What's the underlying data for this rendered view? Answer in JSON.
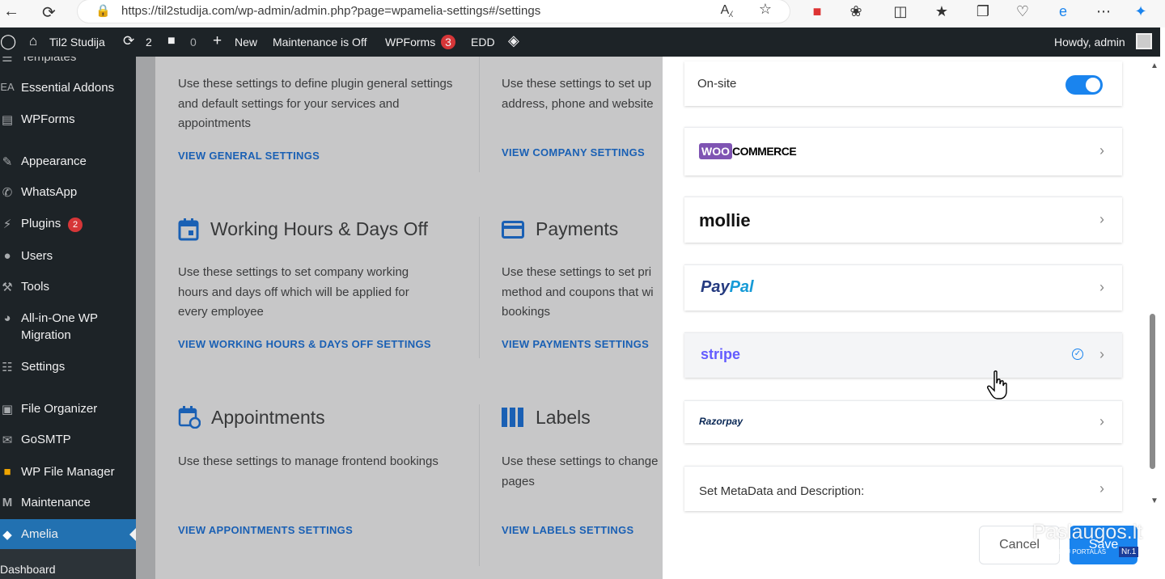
{
  "browser": {
    "url": "https://til2studija.com/wp-admin/admin.php?page=wpamelia-settings#/settings"
  },
  "adminbar": {
    "site_name": "Til2 Studija",
    "updates_count": "2",
    "comments_count": "0",
    "new_label": "New",
    "maintenance_label": "Maintenance is Off",
    "wpforms_label": "WPForms",
    "wpforms_badge": "3",
    "edd_label": "EDD",
    "howdy": "Howdy, admin"
  },
  "sidebar": {
    "items": [
      {
        "label": "Templates",
        "icon": "templates-icon"
      },
      {
        "label": "Essential Addons",
        "icon": "ea-icon"
      },
      {
        "label": "WPForms",
        "icon": "forms-icon"
      },
      {
        "label": "Appearance",
        "icon": "brush-icon"
      },
      {
        "label": "WhatsApp",
        "icon": "whatsapp-icon"
      },
      {
        "label": "Plugins",
        "icon": "plugin-icon",
        "badge": "2"
      },
      {
        "label": "Users",
        "icon": "users-icon"
      },
      {
        "label": "Tools",
        "icon": "wrench-icon"
      },
      {
        "label": "All-in-One WP",
        "label2": "Migration",
        "icon": "migration-icon"
      },
      {
        "label": "Settings",
        "icon": "settings-icon"
      },
      {
        "label": "File Organizer",
        "icon": "folder-icon"
      },
      {
        "label": "GoSMTP",
        "icon": "mail-icon"
      },
      {
        "label": "WP File Manager",
        "icon": "filemanager-icon"
      },
      {
        "label": "Maintenance",
        "icon": "maintenance-icon"
      },
      {
        "label": "Amelia",
        "icon": "amelia-icon"
      }
    ],
    "submenu_first": "Dashboard"
  },
  "main": {
    "general": {
      "desc": "Use these settings to define plugin general settings and default settings for your services and appointments",
      "link": "VIEW GENERAL SETTINGS"
    },
    "company": {
      "desc": "Use these settings to set up address, phone and website",
      "link": "VIEW COMPANY SETTINGS"
    },
    "working_hours": {
      "title": "Working Hours & Days Off",
      "desc": "Use these settings to set company working hours and days off which will be applied for every employee",
      "link": "VIEW WORKING HOURS & DAYS OFF SETTINGS"
    },
    "payments": {
      "title": "Payments",
      "desc": "Use these settings to set pri method and coupons that wi bookings",
      "link": "VIEW PAYMENTS SETTINGS"
    },
    "appointments": {
      "title": "Appointments",
      "desc": "Use these settings to manage frontend bookings",
      "link": "VIEW APPOINTMENTS SETTINGS"
    },
    "labels": {
      "title": "Labels",
      "desc": "Use these settings to change pages",
      "link": "VIEW LABELS SETTINGS"
    }
  },
  "dialog": {
    "onsite_label": "On-site",
    "onsite_enabled": true,
    "gateways": [
      {
        "name": "WOOCOMMERCE",
        "woo": "WOO",
        "commerce": "COMMERCE"
      },
      {
        "name": "mollie"
      },
      {
        "name": "PayPal",
        "pay": "Pay",
        "pal": "Pal"
      },
      {
        "name": "stripe",
        "enabled": true
      },
      {
        "name": "Razorpay"
      }
    ],
    "metadata_label": "Set MetaData and Description:",
    "cancel_label": "Cancel",
    "save_label": "Save"
  },
  "watermark": {
    "text": "Paslaugos.lt",
    "subtext": "PASLAUGŲ PORTALAS",
    "badge": "Nr.1"
  },
  "colors": {
    "accent": "#1a84ee",
    "wp_dark": "#1d2327",
    "wp_blue": "#2271b1",
    "link_blue": "#1a60b4",
    "woo_purple": "#7f54b3",
    "paypal_dark": "#253b80",
    "paypal_light": "#179bd7",
    "stripe": "#635bff"
  }
}
